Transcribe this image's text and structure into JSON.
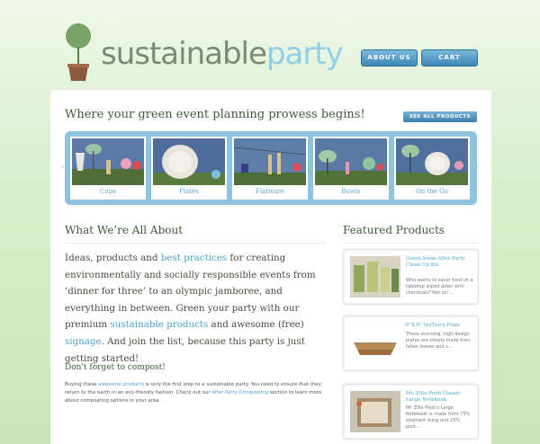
{
  "header": {
    "logo_part1": "sustainable",
    "logo_part2": "party",
    "about_label": "ABOUT US",
    "cart_label": "CART"
  },
  "hero": {
    "tagline": "Where your green event planning prowess begins!",
    "see_all_label": "SEE ALL PRODUCTS",
    "tiles": [
      {
        "label": "Cups"
      },
      {
        "label": "Plates"
      },
      {
        "label": "Flatware"
      },
      {
        "label": "Bowls"
      },
      {
        "label": "On the Go"
      }
    ]
  },
  "about": {
    "heading": "What We’re All About",
    "p1a": "Ideas, products and ",
    "p1_link": "best practices",
    "p1b": " for creating environmentally and socially responsible events from ‘dinner for three’ to an olympic jamboree, and everything in between. Green your party with our premium ",
    "p1_link2": "sustainable products",
    "p1c": " and awesome (free) ",
    "p1_link3": "signage",
    "p1d": ". And join the list, because this party is just getting started!",
    "compost_heading": "Don't forget to compost!",
    "c_a": "Buying these ",
    "c_link1": "awesome products",
    "c_b": " is only the first step to a sustainable party. You need to ensure that they return to the earth in an eco-friendly fashion. Check out our ",
    "c_link2": "After Party Composting",
    "c_c": " section to learn more about composting options in your area."
  },
  "featured": {
    "heading": "Featured Products",
    "items": [
      {
        "title": "Green Irene After-Party Clean Up Kit",
        "desc": "Who wants to savor food on a tabletop wiped down with chemicals? Not us! ..."
      },
      {
        "title": "6\"X 6\" VerTerra Plate",
        "desc": "These stunning, high-design plates are simply made from fallen leaves and s..."
      },
      {
        "title": "Mr. Ellie Pooh Classic Large Notebook",
        "desc": "Mr. Ellie Pooh's Large Notebook is made from 75% elephant dung and 25% post..."
      }
    ]
  }
}
